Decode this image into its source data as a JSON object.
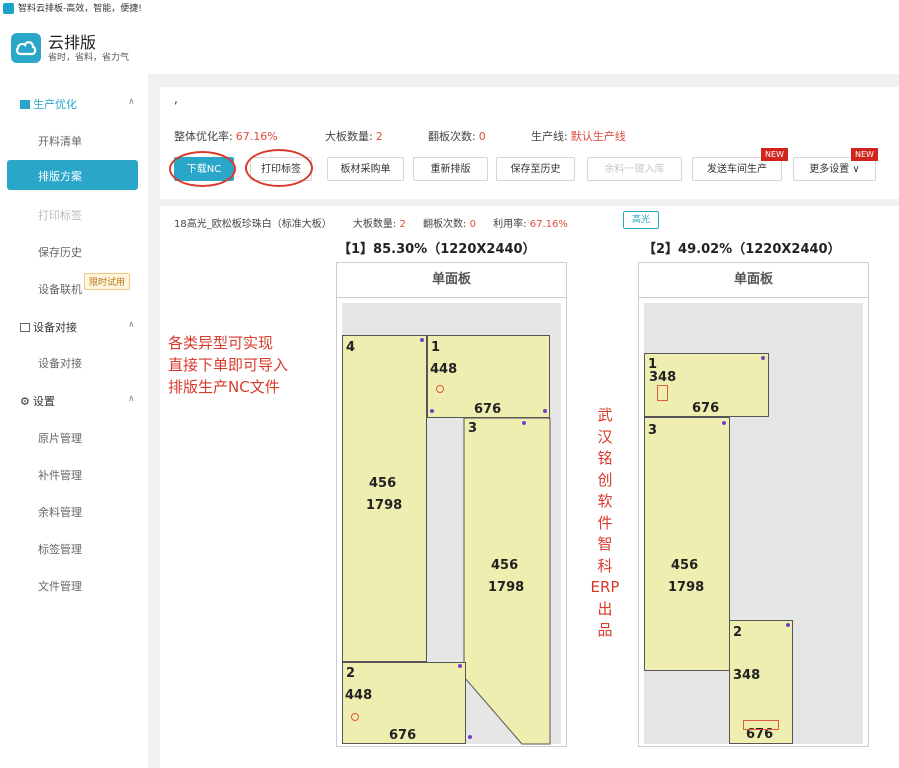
{
  "window": {
    "title": "智料云排板-高效，智能，便捷!"
  },
  "app": {
    "name": "云排版",
    "slogan": "省时，省料，省力气"
  },
  "sidebar": {
    "groups": [
      {
        "label": "生产优化",
        "items": [
          "开料清单",
          "排版方案",
          "打印标签",
          "保存历史",
          "设备联机"
        ]
      },
      {
        "label": "设备对接",
        "items": [
          "设备对接"
        ]
      },
      {
        "label": "设置",
        "items": [
          "原片管理",
          "补件管理",
          "余料管理",
          "标签管理",
          "文件管理"
        ]
      }
    ],
    "active_item": "排版方案",
    "trial_badge": "限时试用"
  },
  "summary": {
    "comma": ",",
    "labels": {
      "rate": "整体优化率:",
      "boards": "大板数量:",
      "flips": "翻板次数:",
      "line": "生产线:"
    },
    "values": {
      "rate": "67.16%",
      "boards": "2",
      "flips": "0",
      "line": "默认生产线"
    }
  },
  "toolbar": {
    "download_nc": "下载NC",
    "print_labels": "打印标签",
    "material_list": "板材采购单",
    "relayout": "重新排版",
    "save_history": "保存至历史",
    "remnant": "余料一键入库",
    "send_workshop": "发送车间生产",
    "more": "更多设置",
    "new_badge": "NEW",
    "chevron": "∨"
  },
  "plan_info": {
    "material": "18高光_欧松板珍珠白（标准大板）",
    "boards_label": "大板数量:",
    "boards": "2",
    "flips_label": "翻板次数:",
    "flips": "0",
    "usage_label": "利用率:",
    "usage": "67.16%",
    "highlight_button": "高光"
  },
  "boards": [
    {
      "title": "【1】85.30%（1220X2440）",
      "head": "单面板",
      "parts": [
        {
          "id": "4",
          "w": "456",
          "h": "1798"
        },
        {
          "id": "1",
          "w": "676",
          "h": "448"
        },
        {
          "id": "3",
          "w": "456",
          "h": "1798"
        },
        {
          "id": "2",
          "w": "676",
          "h": "448"
        }
      ]
    },
    {
      "title": "【2】49.02%（1220X2440）",
      "head": "单面板",
      "parts": [
        {
          "id": "1",
          "w": "676",
          "h": "348"
        },
        {
          "id": "3",
          "w": "456",
          "h": "1798"
        },
        {
          "id": "2",
          "w": "348",
          "h": "676"
        }
      ]
    }
  ],
  "annotations": {
    "left": [
      "各类异型可实现",
      "直接下单即可导入",
      "排版生产NC文件"
    ],
    "middle": [
      "武",
      "汉",
      "铭",
      "创",
      "软",
      "件",
      "智",
      "科",
      "ERP",
      "出",
      "品"
    ]
  },
  "colors": {
    "accent": "#2aa6c8",
    "value_red": "#e04b3c",
    "annotation_red": "#d93a2b",
    "part_fill": "#eeeeb0",
    "new_badge": "#d0251c"
  }
}
